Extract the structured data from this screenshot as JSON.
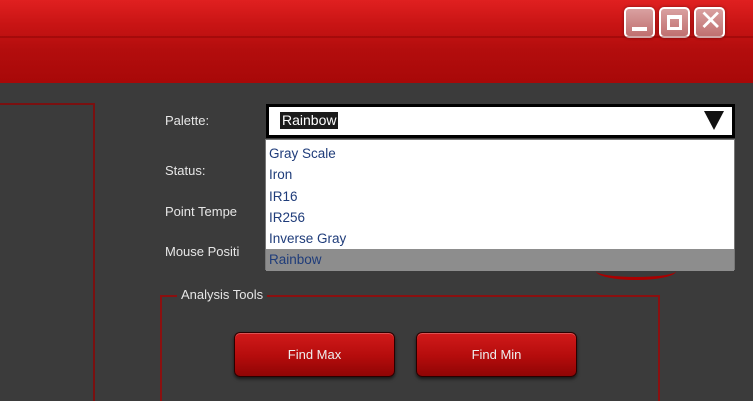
{
  "window": {
    "minimize_icon": "minimize-icon",
    "maximize_icon": "maximize-icon",
    "close_icon": "close-icon",
    "accent_color": "#c81414"
  },
  "labels": {
    "palette": "Palette:",
    "status": "Status:",
    "point_temperature": "Point Tempe",
    "mouse_position": "Mouse Positi"
  },
  "palette": {
    "selected": "Rainbow",
    "options": [
      "Gray Scale",
      "Iron",
      "IR16",
      "IR256",
      "Inverse Gray",
      "Rainbow"
    ]
  },
  "analysis_tools": {
    "title": "Analysis Tools",
    "find_max": "Find Max",
    "find_min": "Find Min"
  }
}
